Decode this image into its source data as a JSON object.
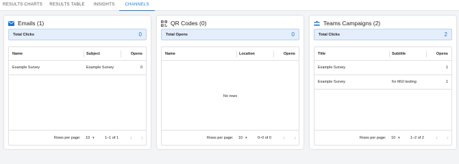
{
  "tabs": [
    {
      "label": "RESULTS CHARTS"
    },
    {
      "label": "RESULTS TABLE"
    },
    {
      "label": "INSIGHTS"
    },
    {
      "label": "CHANNELS"
    }
  ],
  "colors": {
    "accent": "#1976d2",
    "summary_bg": "#e4eefa",
    "summary_border": "#bcd3ee"
  },
  "cards": [
    {
      "icon": "envelope-icon",
      "title": "Emails (1)",
      "summary_label": "Total Clicks",
      "summary_value": "0",
      "columns": [
        "Name",
        "Subject",
        "Opens"
      ],
      "rows": [
        [
          "Example Survey",
          "Example Survey",
          "0"
        ]
      ],
      "empty_text": "",
      "footer": {
        "rows_per_page_label": "Rows per page:",
        "rows_per_page": "10",
        "range": "1–1 of 1"
      }
    },
    {
      "icon": "qr-code-icon",
      "title": "QR Codes (0)",
      "summary_label": "Total Opens",
      "summary_value": "0",
      "columns": [
        "Name",
        "Location",
        "Opens"
      ],
      "rows": [],
      "empty_text": "No rows",
      "footer": {
        "rows_per_page_label": "Rows per page:",
        "rows_per_page": "10",
        "range": "0–0 of 0"
      }
    },
    {
      "icon": "teams-icon",
      "title": "Teams Campaigns (2)",
      "summary_label": "Total Clicks",
      "summary_value": "2",
      "columns": [
        "Title",
        "Subtitle",
        "Opens"
      ],
      "rows": [
        [
          "Example Survey",
          "",
          "1"
        ],
        [
          "Example Survey",
          "for MUI testing",
          "1"
        ]
      ],
      "empty_text": "",
      "footer": {
        "rows_per_page_label": "Rows per page:",
        "rows_per_page": "10",
        "range": "1–2 of 2"
      }
    }
  ]
}
